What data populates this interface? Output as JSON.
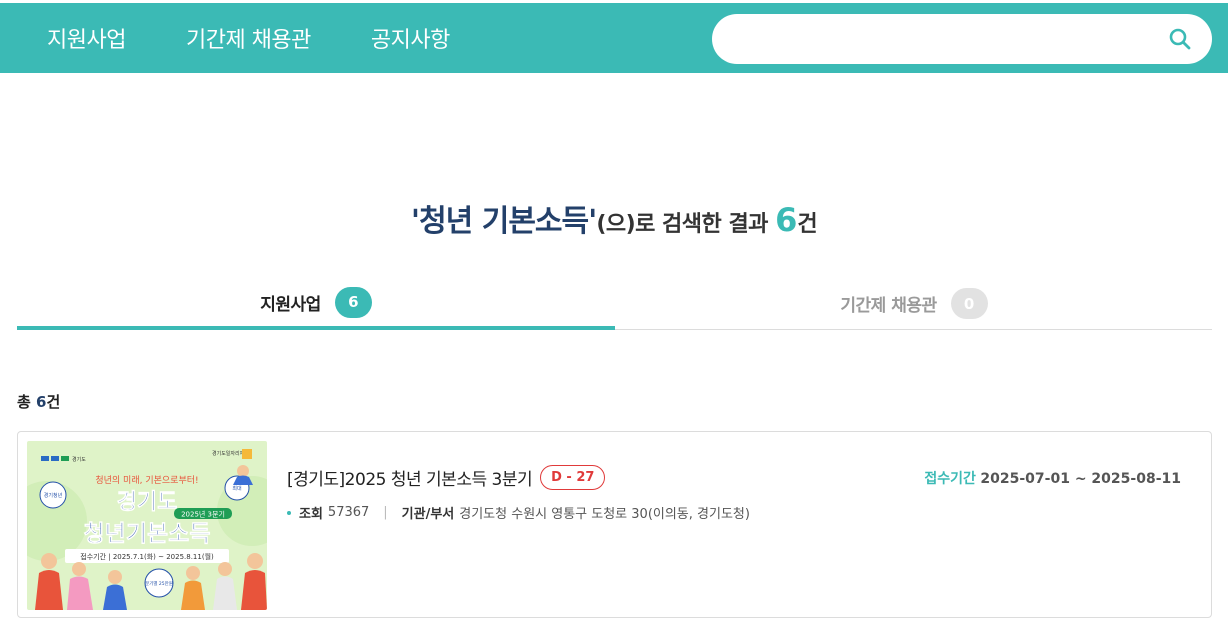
{
  "nav": {
    "items": [
      {
        "label": "지원사업"
      },
      {
        "label": "기간제 채용관"
      },
      {
        "label": "공지사항"
      }
    ]
  },
  "search": {
    "value": "",
    "placeholder": "",
    "icon": "search-icon"
  },
  "result": {
    "query": "'청년 기본소득'",
    "suffix": "(으)로 검색한 결과 ",
    "count": "6",
    "unit": "건"
  },
  "tabs": [
    {
      "label": "지원사업",
      "count": "6",
      "active": true
    },
    {
      "label": "기간제 채용관",
      "count": "0",
      "active": false
    }
  ],
  "total": {
    "prefix": "총 ",
    "count": "6",
    "unit": "건"
  },
  "list": [
    {
      "title": "[경기도]2025 청년 기본소득 3분기",
      "dday": "D - 27",
      "period_label": "접수기간",
      "period_value": "2025-07-01 ~ 2025-08-11",
      "views_label": "조회",
      "views_value": "57367",
      "separator": "|",
      "org_label": "기관/부서",
      "org_value": "경기도청 수원시 영통구 도청로 30(이의동, 경기도청)",
      "thumb": {
        "logo": "경기도",
        "slogan": "청년의 미래, 기본으로부터!",
        "corner": "경기도일자리재단",
        "title1": "경기도",
        "quarter": "2025년 3분기",
        "title2": "청년기본소득",
        "period": "접수기간  |  2025.7.1(화) ~ 2025.8.11(월)",
        "bubble1": "경기청년",
        "bubble2": "최대",
        "bubble3": "분기별 25만원"
      }
    }
  ],
  "colors": {
    "brand": "#3bbab5",
    "navy": "#23406a",
    "dday": "#e03a3a"
  }
}
